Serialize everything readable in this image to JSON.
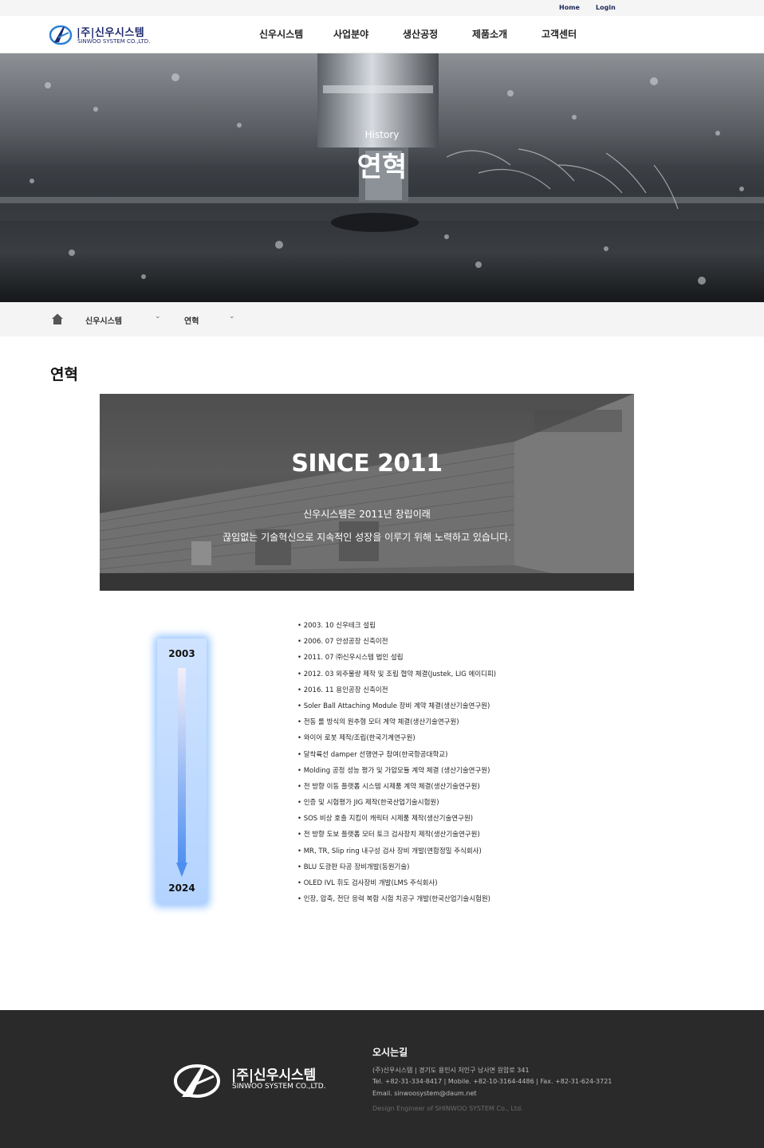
{
  "topbar": {
    "home": "Home",
    "login": "Login"
  },
  "logo": {
    "ko": "|주|신우시스템",
    "en": "SINWOO SYSTEM CO.,LTD."
  },
  "nav": [
    "신우시스템",
    "사업분야",
    "생산공정",
    "제품소개",
    "고객센터"
  ],
  "hero": {
    "subtitle": "History",
    "title": "연혁"
  },
  "breadcrumb": {
    "level1": "신우시스템",
    "level2": "연혁"
  },
  "page_title": "연혁",
  "since": {
    "title": "SINCE 2011",
    "line1": "신우시스템은 2011년 창립이래",
    "line2": "끊임없는 기술혁신으로 지속적인 성장을 이루기 위해 노력하고 있습니다."
  },
  "timeline": {
    "start_year": "2003",
    "end_year": "2024"
  },
  "history": [
    "2003. 10 신우테크 설립",
    "2006. 07 안성공장 신축이전",
    "2011. 07 ㈜신우시스템 법인 설립",
    "2012. 03 외주물량 제작 및 조립 협약 체결(Justek, LIG 에이디피)",
    "2016. 11 용인공장 신축이전",
    "Soler Ball Attaching Module 장비 계약 체결(생산기술연구원)",
    "전동 롤 방식의 원추형 모터 계약 체결(생산기술연구원)",
    "와이어 로봇 제작/조립(한국기계연구원)",
    "달착륙선 damper 선행연구 참여(한국항공대학교)",
    "Molding 공정 성능 평가 및 가압모듈 계약 체결 (생산기술연구원)",
    "전 방향 이동 플랫폼 시스템 시제품 계약 체결(생산기술연구원)",
    "인증 및 시험평가 JIG 제작(한국산업기술시험원)",
    "SOS 비상 호출 지킴이 캐릭터 시제품 제작(생산기술연구원)",
    "전 방향 도보 플랫폼 모터 토크 검사장치 제작(생산기술연구원)",
    "MR, TR, Slip ring 내구성 검사 장비 개발(연합정밀 주식회사)",
    "BLU 도광판 타공 장비개발(동원기술)",
    "OLED IVL 휘도 검사장비 개발(LMS 주식회사)",
    "인장, 압축, 전단 응력 복합 시험 치공구 개발(한국산업기술시험원)"
  ],
  "footer": {
    "title": "오시는길",
    "address": "(주)신우시스템   |   경기도 용인시 처인구 남사면 원암로 341",
    "contact": "Tel. +82-31-334-8417   |   Mobile. +82-10-3164-4486   |   Fax. +82-31-624-3721",
    "email": "Email. sinwoosystem@daum.net",
    "copyright": "Design Engineer of SHINWOO SYSTEM Co., Ltd."
  },
  "colors": {
    "brand": "#1d2a6e",
    "footer_bg": "#2b2a2a",
    "timeline_glow": "#78b4ff"
  }
}
